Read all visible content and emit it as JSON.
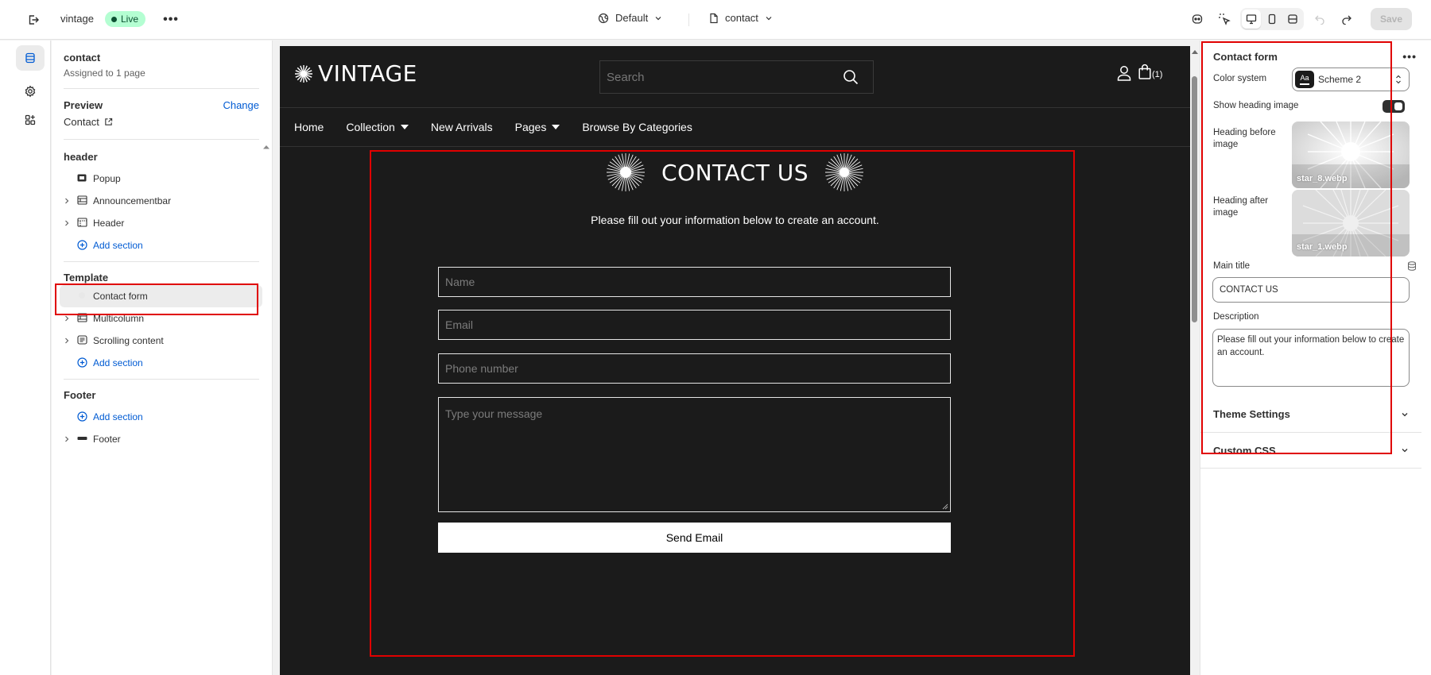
{
  "topbar": {
    "store_name": "vintage",
    "live_label": "Live",
    "more_label": "•••",
    "theme_label": "Default",
    "page_label": "contact",
    "save_label": "Save"
  },
  "sidebar": {
    "page_title": "contact",
    "page_sub": "Assigned to 1 page",
    "preview_label": "Preview",
    "change_label": "Change",
    "preview_value": "Contact",
    "groups": {
      "header": {
        "title": "header",
        "items": [
          "Popup",
          "Announcementbar",
          "Header"
        ],
        "add_label": "Add section"
      },
      "template": {
        "title": "Template",
        "items": [
          "Contact form",
          "Multicolumn",
          "Scrolling content"
        ],
        "add_label": "Add section"
      },
      "footer": {
        "title": "Footer",
        "add_label": "Add section",
        "items": [
          "Footer"
        ]
      }
    }
  },
  "store": {
    "logo": "VINTAGE",
    "search_placeholder": "Search",
    "cart_count": "(1)",
    "nav": [
      "Home",
      "Collection",
      "New Arrivals",
      "Pages",
      "Browse By Categories"
    ],
    "contact_title": "CONTACT US",
    "contact_desc": "Please fill out your information below to create an account.",
    "fields": {
      "name": "Name",
      "email": "Email",
      "phone": "Phone number",
      "message": "Type your message"
    },
    "send_label": "Send Email"
  },
  "settings": {
    "title": "Contact form",
    "more_label": "•••",
    "color_system_label": "Color system",
    "scheme_swatch": "Aa",
    "scheme_value": "Scheme 2",
    "show_heading_image_label": "Show heading image",
    "show_heading_image": true,
    "heading_before_label": "Heading before image",
    "heading_before_file": "star_8.webp",
    "heading_after_label": "Heading after image",
    "heading_after_file": "star_1.webp",
    "main_title_label": "Main title",
    "main_title_value": "CONTACT US",
    "description_label": "Description",
    "description_value": "Please fill out your information below to create an account.",
    "theme_settings_label": "Theme Settings",
    "custom_css_label": "Custom CSS"
  },
  "colors": {
    "accent_blue": "#005bd3",
    "highlight_red": "#e00000",
    "store_bg": "#1b1b1b",
    "live_badge_bg": "#b4fed2"
  }
}
